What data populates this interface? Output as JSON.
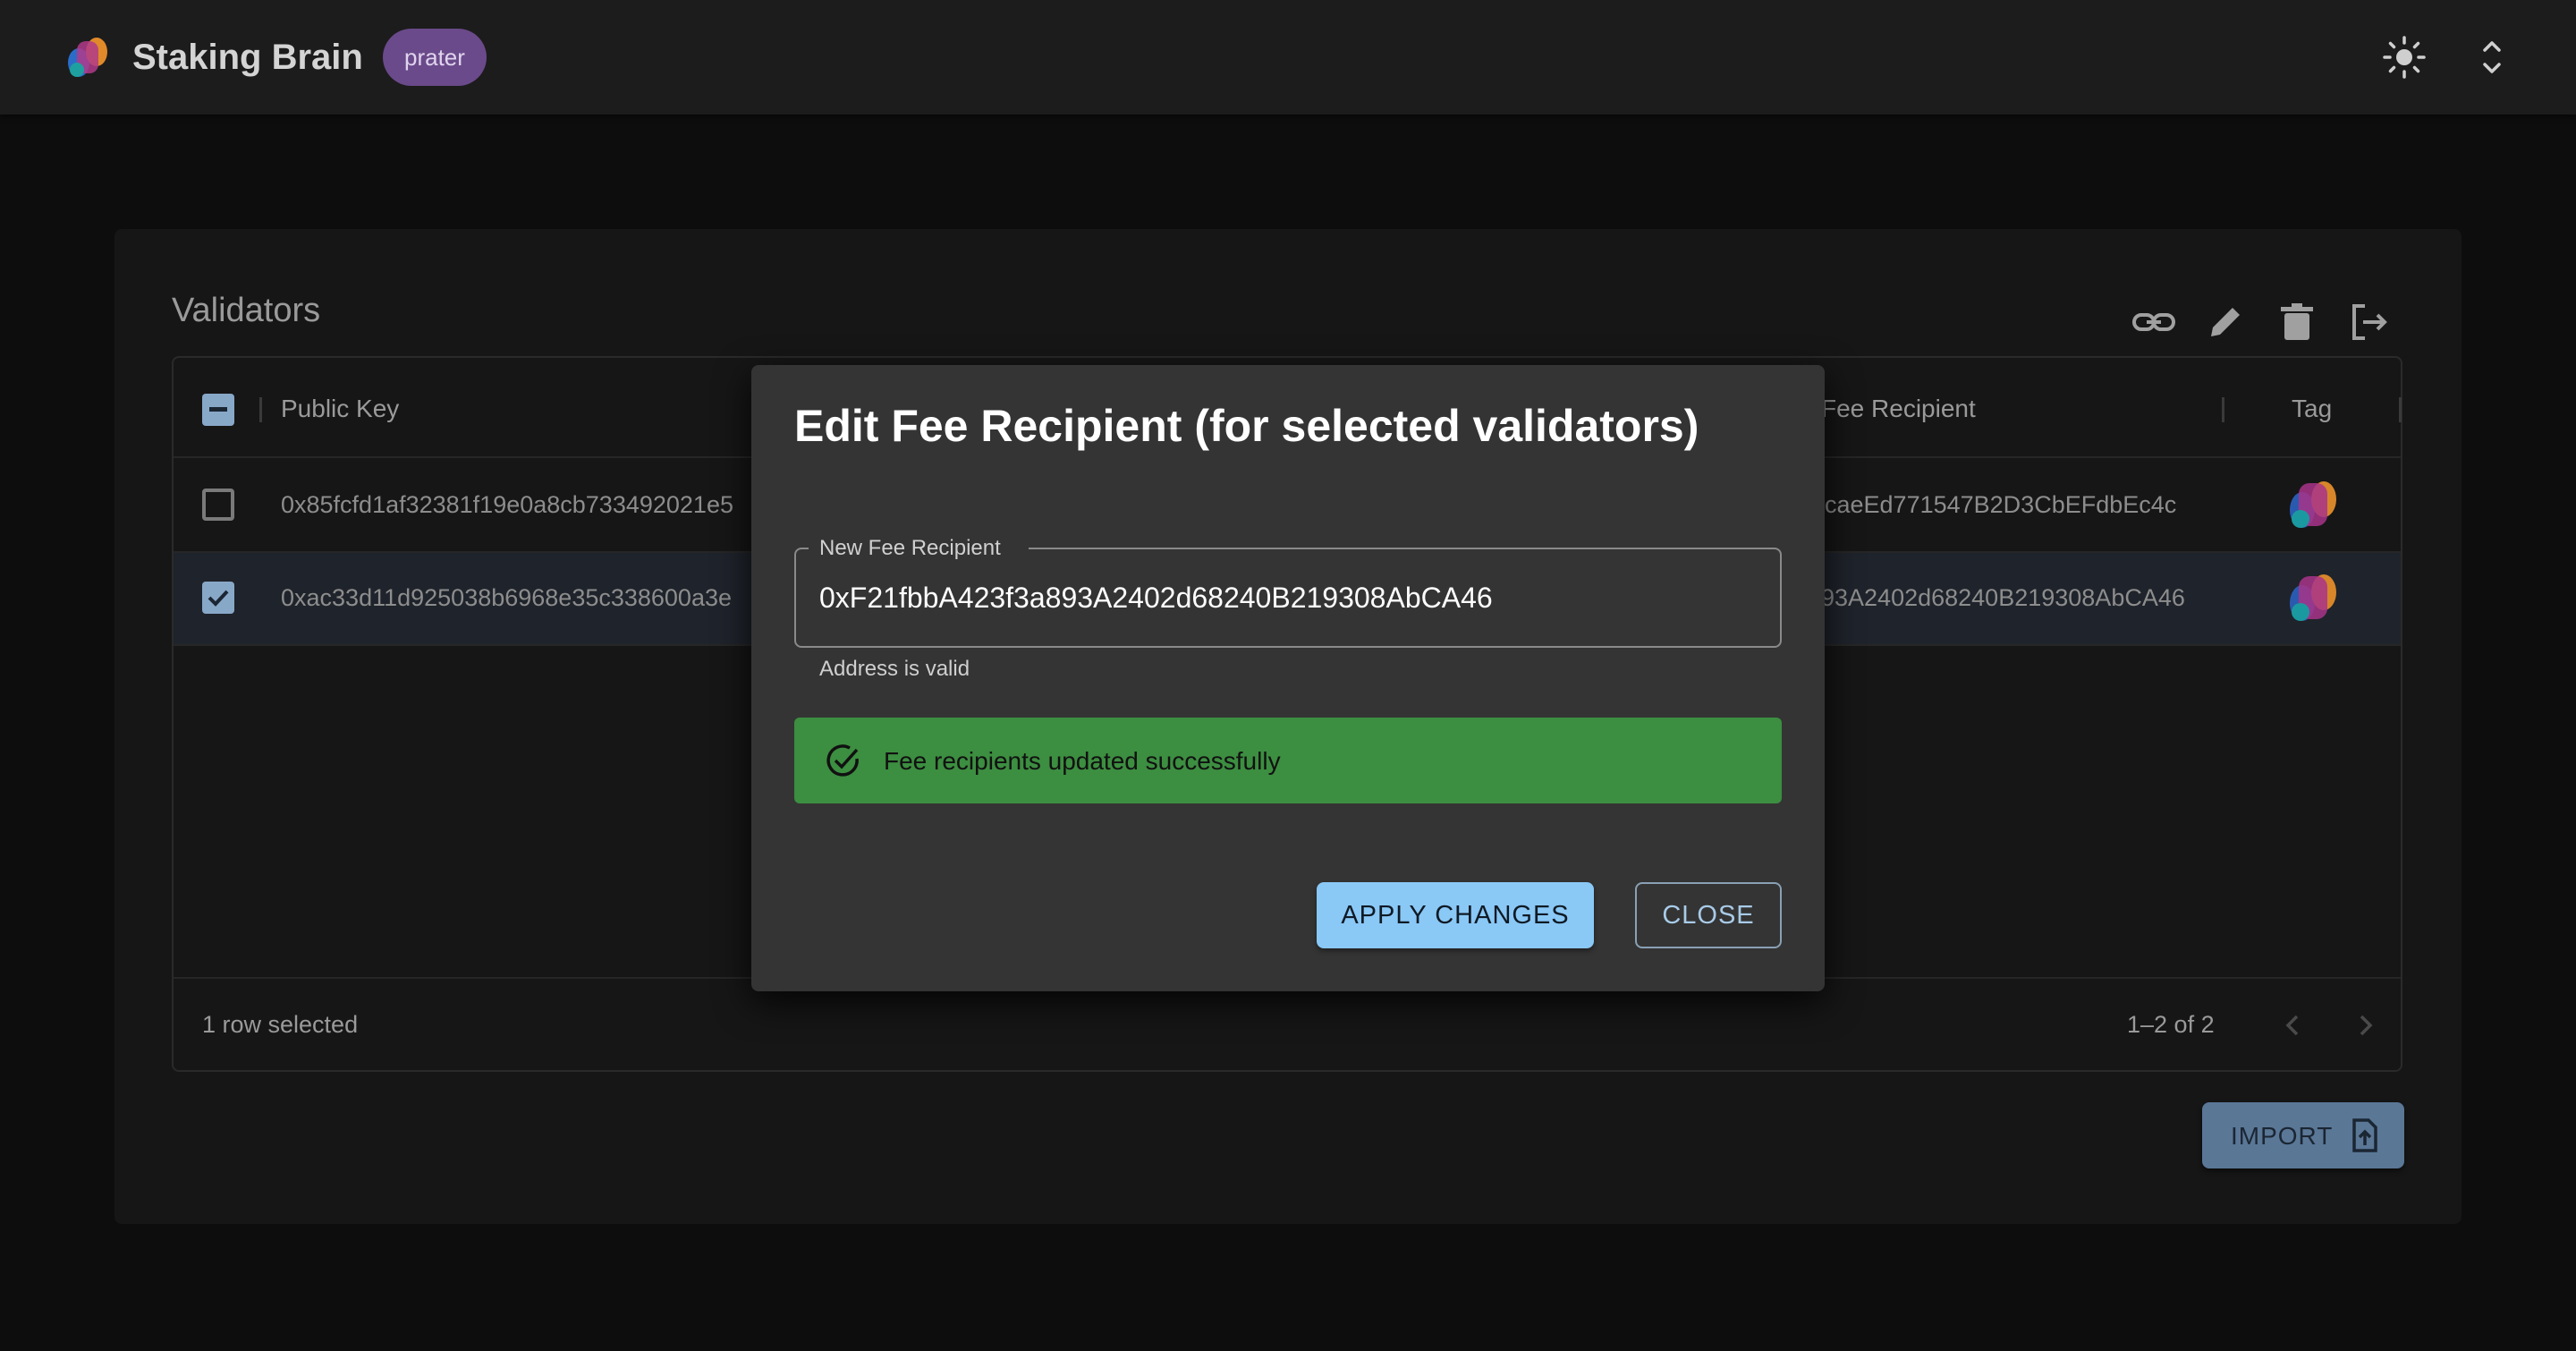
{
  "app": {
    "title": "Staking Brain",
    "network": "prater"
  },
  "card": {
    "title": "Validators"
  },
  "table": {
    "headers": {
      "public_key": "Public Key",
      "fee_recipient": "Fee Recipient",
      "tag": "Tag"
    },
    "rows": [
      {
        "checked": false,
        "public_key": "0x85fcfd1af32381f19e0a8cb733492021e5",
        "fee_recipient": "caeEd771547B2D3CbEFdbEc4c"
      },
      {
        "checked": true,
        "public_key": "0xac33d11d925038b6968e35c338600a3e",
        "fee_recipient": "93A2402d68240B219308AbCA46"
      }
    ],
    "footer": {
      "selected": "1 row selected",
      "pagination": "1–2 of 2"
    }
  },
  "import_button": "IMPORT",
  "dialog": {
    "title": "Edit Fee Recipient (for selected validators)",
    "field_label": "New Fee Recipient",
    "field_value": "0xF21fbbA423f3a893A2402d68240B219308AbCA46",
    "helper": "Address is valid",
    "alert": "Fee recipients updated successfully",
    "apply_label": "APPLY CHANGES",
    "close_label": "CLOSE"
  },
  "colors": {
    "accent": "#8ac8f6",
    "success": "#3c8e40",
    "network_chip": "#6a4a8a"
  }
}
